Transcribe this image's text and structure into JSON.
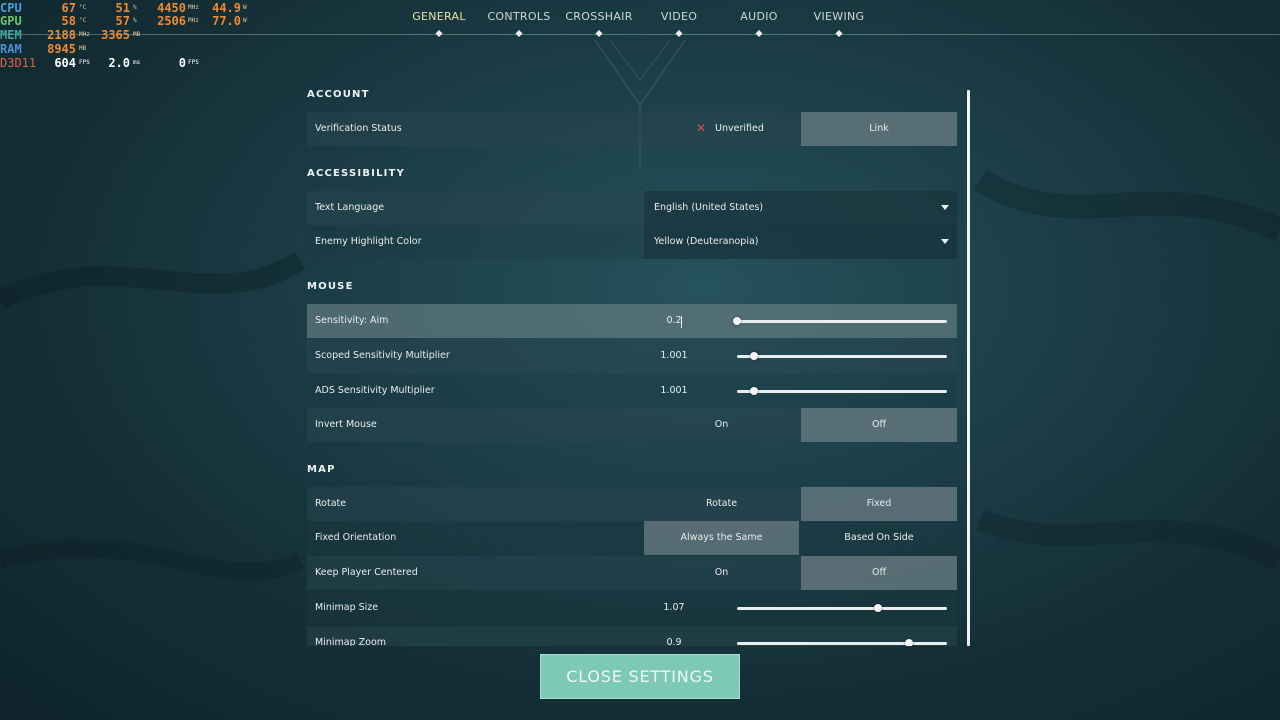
{
  "nav": {
    "tabs": [
      {
        "label": "GENERAL",
        "active": true
      },
      {
        "label": "CONTROLS",
        "active": false
      },
      {
        "label": "CROSSHAIR",
        "active": false
      },
      {
        "label": "VIDEO",
        "active": false
      },
      {
        "label": "AUDIO",
        "active": false
      },
      {
        "label": "VIEWING",
        "active": false
      }
    ]
  },
  "hud": {
    "cpu": {
      "label": "CPU",
      "temp": "67",
      "temp_unit": "°C",
      "load": "51",
      "load_unit": "%",
      "clock": "4450",
      "clock_unit": "MHz",
      "power": "44.9",
      "power_unit": "W"
    },
    "gpu": {
      "label": "GPU",
      "temp": "58",
      "temp_unit": "°C",
      "load": "57",
      "load_unit": "%",
      "clock": "2506",
      "clock_unit": "MHz",
      "power": "77.0",
      "power_unit": "W"
    },
    "mem": {
      "label": "MEM",
      "clock": "2188",
      "clock_unit": "MHz",
      "used": "3365",
      "used_unit": "MB"
    },
    "ram": {
      "label": "RAM",
      "used": "8945",
      "used_unit": "MB"
    },
    "d3d": {
      "label": "D3D11",
      "fps": "604",
      "fps_unit": "FPS",
      "frametime": "2.0",
      "frametime_unit": "ms",
      "fps2": "0",
      "fps2_unit": "FPS"
    }
  },
  "sections": {
    "account": {
      "title": "ACCOUNT",
      "verification": {
        "label": "Verification Status",
        "status": "Unverified",
        "action": "Link"
      }
    },
    "accessibility": {
      "title": "ACCESSIBILITY",
      "text_language": {
        "label": "Text Language",
        "value": "English (United States)"
      },
      "enemy_highlight": {
        "label": "Enemy Highlight Color",
        "value": "Yellow (Deuteranopia)"
      }
    },
    "mouse": {
      "title": "MOUSE",
      "sens_aim": {
        "label": "Sensitivity: Aim",
        "value": "0.2",
        "level": 0.0
      },
      "scoped_mult": {
        "label": "Scoped Sensitivity Multiplier",
        "value": "1.001",
        "level": 0.08
      },
      "ads_mult": {
        "label": "ADS Sensitivity Multiplier",
        "value": "1.001",
        "level": 0.08
      },
      "invert": {
        "label": "Invert Mouse",
        "on": "On",
        "off": "Off",
        "selected": "Off"
      }
    },
    "map": {
      "title": "MAP",
      "rotate": {
        "label": "Rotate",
        "opt1": "Rotate",
        "opt2": "Fixed",
        "selected": "Fixed"
      },
      "fixed_orientation": {
        "label": "Fixed Orientation",
        "opt1": "Always the Same",
        "opt2": "Based On Side",
        "selected": "Always the Same"
      },
      "keep_centered": {
        "label": "Keep Player Centered",
        "on": "On",
        "off": "Off",
        "selected": "Off"
      },
      "minimap_size": {
        "label": "Minimap Size",
        "value": "1.07",
        "level": 0.67
      },
      "minimap_zoom": {
        "label": "Minimap Zoom",
        "value": "0.9",
        "level": 0.82
      }
    }
  },
  "close_button": {
    "label": "CLOSE SETTINGS"
  },
  "colors": {
    "accent": "#7ec9b6",
    "active_tab": "#e7e3a4",
    "error": "#e64d55"
  }
}
